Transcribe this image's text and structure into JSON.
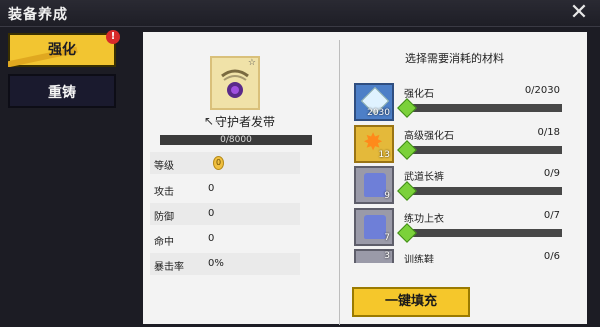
{
  "window": {
    "title": "装备养成",
    "close_label": "✕"
  },
  "tabs": [
    {
      "label": "强化",
      "badge": "!"
    },
    {
      "label": "重铸"
    }
  ],
  "item": {
    "name": "守护者发带",
    "exp": "0/8000"
  },
  "stats": [
    {
      "label": "等级",
      "value": "0"
    },
    {
      "label": "攻击",
      "value": "0"
    },
    {
      "label": "防御",
      "value": "0"
    },
    {
      "label": "命中",
      "value": "0"
    },
    {
      "label": "暴击率",
      "value": "0%"
    }
  ],
  "materials": {
    "title": "选择需要消耗的材料",
    "items": [
      {
        "name": "强化石",
        "count": "0/2030",
        "qty": "2030",
        "icon": "enhance-stone-icon"
      },
      {
        "name": "高级强化石",
        "count": "0/18",
        "qty": "13",
        "icon": "advanced-stone-icon"
      },
      {
        "name": "武道长裤",
        "count": "0/9",
        "qty": "9",
        "icon": "pants-icon"
      },
      {
        "name": "练功上衣",
        "count": "0/7",
        "qty": "7",
        "icon": "jacket-icon"
      },
      {
        "name": "训练鞋",
        "count": "0/6",
        "qty": "3",
        "icon": "shoes-icon"
      }
    ]
  },
  "fill_button": {
    "label": "一键填充"
  }
}
